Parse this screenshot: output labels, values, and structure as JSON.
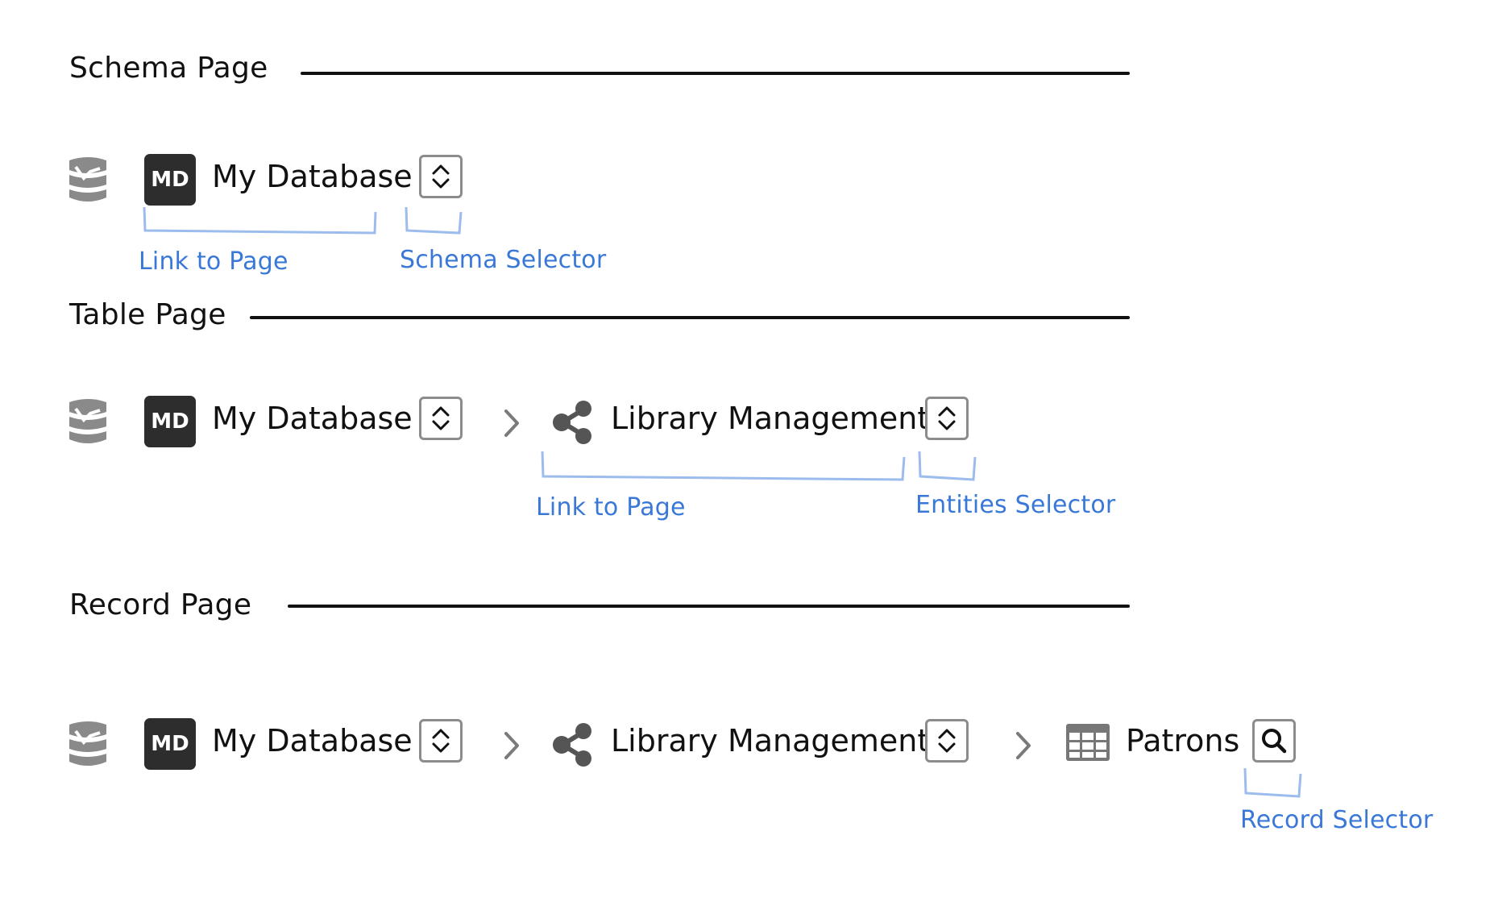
{
  "sections": {
    "schema": {
      "title": "Schema Page",
      "database_name": "My Database",
      "db_badge": "MD",
      "annotations": {
        "link": "Link to Page",
        "selector": "Schema Selector"
      }
    },
    "table": {
      "title": "Table Page",
      "database_name": "My Database",
      "db_badge": "MD",
      "schema_name": "Library Management",
      "annotations": {
        "link": "Link to Page",
        "selector": "Entities Selector"
      }
    },
    "record": {
      "title": "Record Page",
      "database_name": "My Database",
      "db_badge": "MD",
      "schema_name": "Library Management",
      "table_name": "Patrons",
      "annotations": {
        "selector": "Record Selector"
      }
    }
  },
  "colors": {
    "annotation": "#3a78d8",
    "icon_gray": "#7a7a7a",
    "badge_bg": "#2d2d2d"
  },
  "icons": [
    "database-icon",
    "schema-share-icon",
    "table-grid-icon",
    "chevron-right-icon",
    "up-down-icon",
    "search-icon"
  ]
}
